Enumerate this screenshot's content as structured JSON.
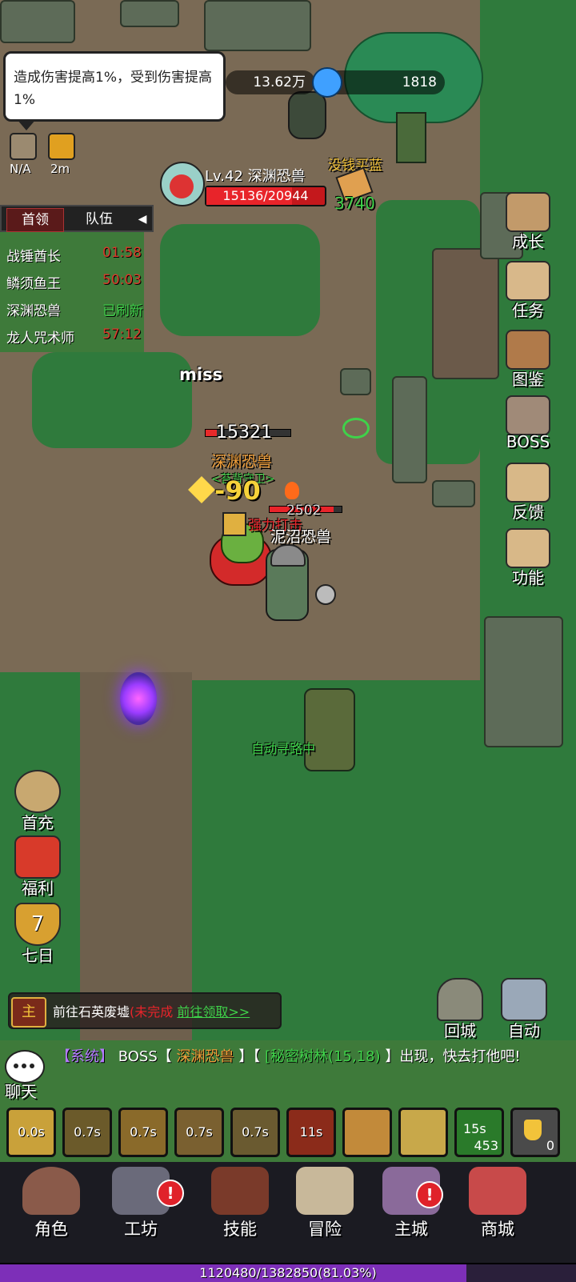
{
  "tooltip": {
    "text": "造成伤害提高1%，受到伤害提高1%"
  },
  "buffs": [
    {
      "icon": "crossed-swords-icon",
      "label": "N/A"
    },
    {
      "icon": "rage-face-icon",
      "label": "2m"
    }
  ],
  "currency": {
    "gold": "13.62万",
    "gems": "1818"
  },
  "boss": {
    "name": "Lv.42 深渊恐兽",
    "hp_text": "15136/20944",
    "hp_fraction": 0.7227
  },
  "pickup": {
    "title": "没钱买蓝",
    "count": "3740"
  },
  "boss_panel": {
    "tabs": [
      "首领",
      "队伍"
    ],
    "rows": [
      {
        "name": "战锤酋长",
        "time": "01:58",
        "color": "#d83a2a"
      },
      {
        "name": "鳞须鱼王",
        "time": "50:03",
        "color": "#d83a2a"
      },
      {
        "name": "深渊恐兽",
        "time": "已刷新",
        "color": "#3fd24a"
      },
      {
        "name": "龙人咒术师",
        "time": "57:12",
        "color": "#d83a2a"
      }
    ]
  },
  "right_menu": [
    "成长",
    "任务",
    "图鉴",
    "BOSS",
    "反馈",
    "功能"
  ],
  "left_menu": [
    "首充",
    "福利",
    "七日"
  ],
  "left_menu_badge": "7",
  "battle": {
    "miss": "miss",
    "enemy_hp_value": "15321",
    "enemy_name": "深渊恐兽",
    "enemy_subtitle": "<苔背守卫>",
    "damage": "-90",
    "player_hp_value": "2502",
    "skill_text": "强力打击",
    "player_name": "泥沼恐兽",
    "auto_path": "自动寻路中"
  },
  "quest": {
    "tag": "主",
    "text": "前往石英废墟",
    "status": "(未完成",
    "action": "前往领取>>"
  },
  "town_buttons": [
    "回城",
    "自动"
  ],
  "chat": {
    "label": "聊天",
    "prefix": "【系统】",
    "body1": "BOSS【",
    "boss": "深渊恐兽",
    "body2": "】【",
    "location": "[秘密树林(15,18)",
    "body3": "】出现，快去打他吧!"
  },
  "skills": [
    {
      "cd": "0.0s",
      "color": "#c9a13a"
    },
    {
      "cd": "0.7s",
      "color": "#6b5a2a"
    },
    {
      "cd": "0.7s",
      "color": "#8a6a2a"
    },
    {
      "cd": "0.7s",
      "color": "#7a6030"
    },
    {
      "cd": "0.7s",
      "color": "#6a5a30"
    },
    {
      "cd": "11s",
      "color": "#8b2b1a"
    },
    {
      "cd": "",
      "color": "#c28a3a"
    },
    {
      "cd": "",
      "color": "#c8a84a"
    }
  ],
  "buff_timer": {
    "time": "15s",
    "count": "453"
  },
  "potion_count": "0",
  "bottom_nav": [
    {
      "label": "角色",
      "badge": ""
    },
    {
      "label": "工坊",
      "badge": "!"
    },
    {
      "label": "技能",
      "badge": ""
    },
    {
      "label": "冒险",
      "badge": ""
    },
    {
      "label": "主城",
      "badge": "!"
    },
    {
      "label": "商城",
      "badge": ""
    }
  ],
  "exp": {
    "text": "1120480/1382850(81.03%)",
    "fraction": 0.8103
  }
}
